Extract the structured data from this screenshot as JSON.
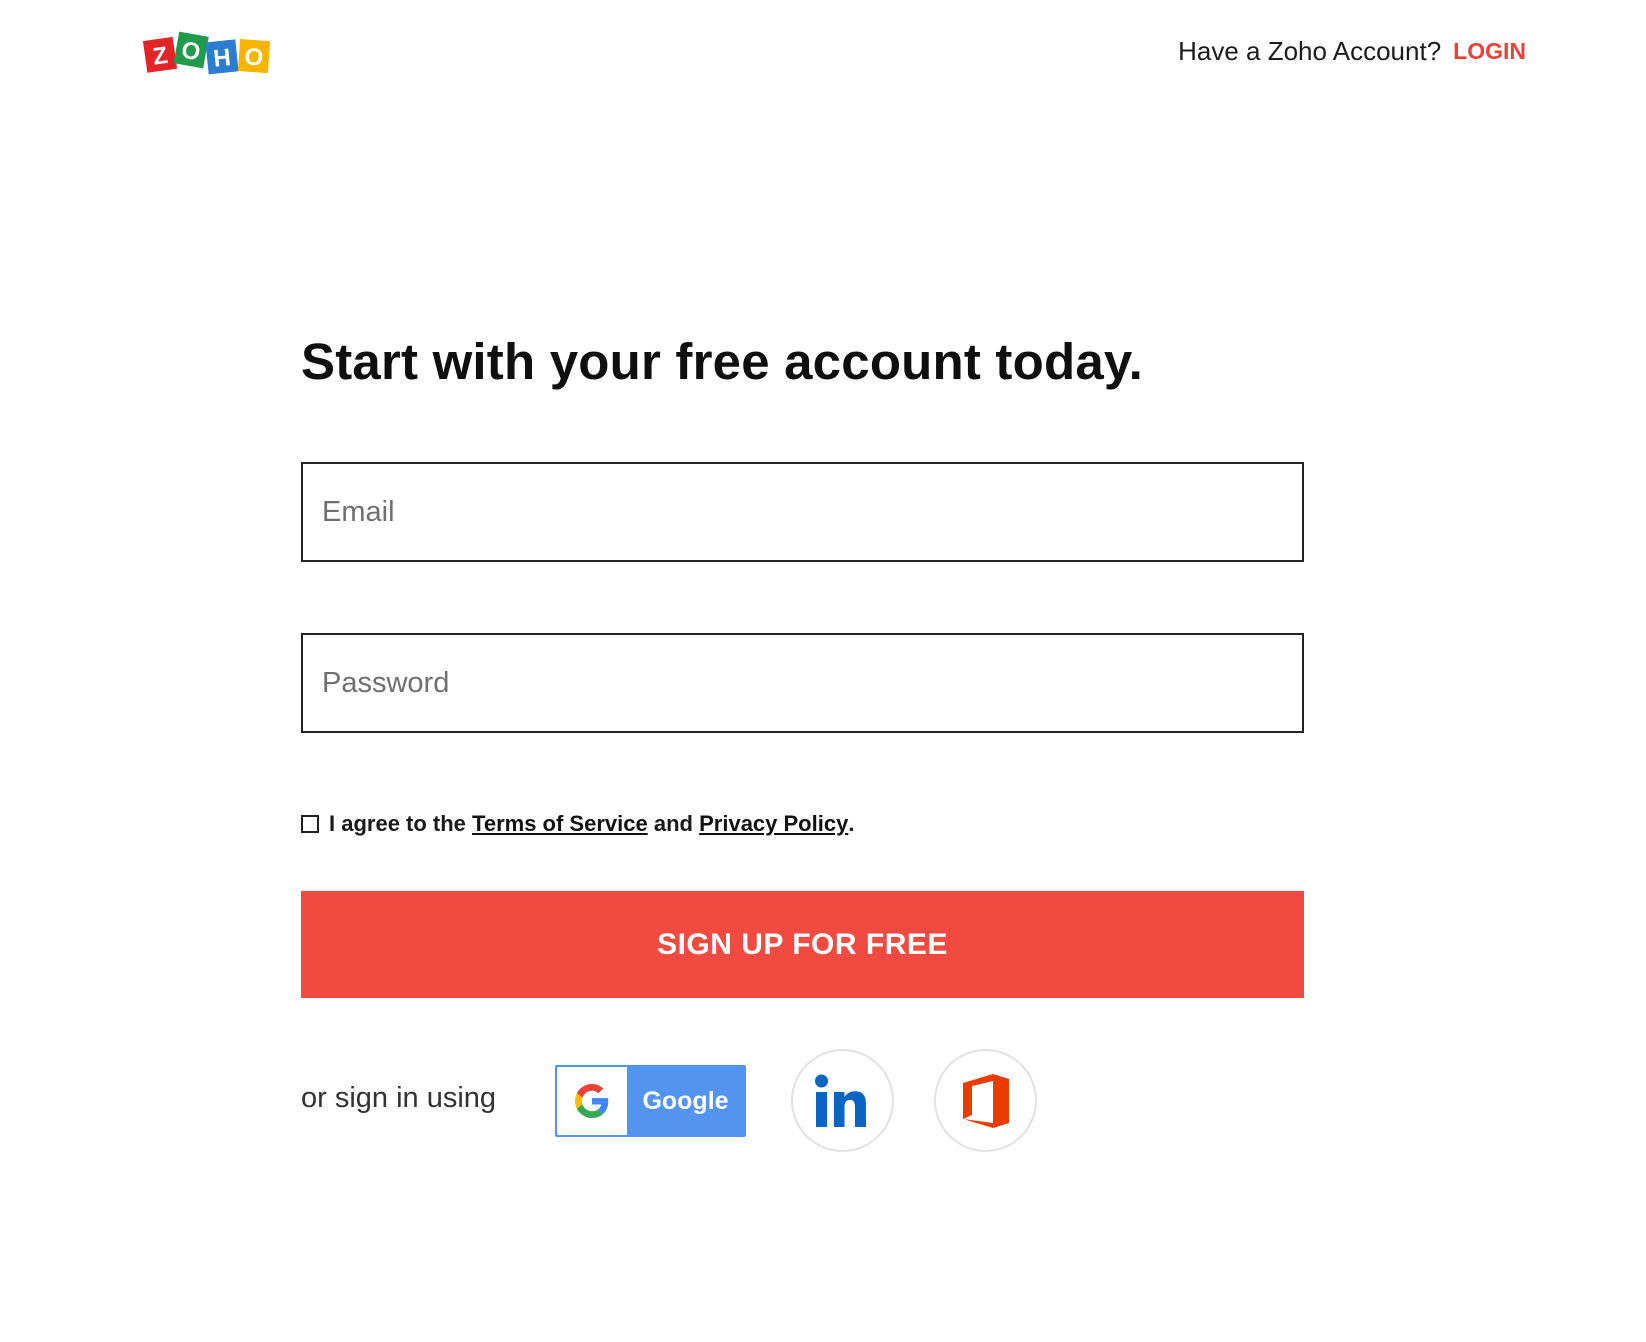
{
  "header": {
    "logo_letters": [
      "Z",
      "O",
      "H",
      "O"
    ],
    "account_prompt": "Have a Zoho Account?",
    "login_label": "LOGIN"
  },
  "form": {
    "heading": "Start with your free account today.",
    "email_placeholder": "Email",
    "password_placeholder": "Password",
    "agree_prefix": "I agree to the",
    "terms_label": "Terms of Service",
    "and_text": "and",
    "privacy_label": "Privacy Policy",
    "period": ".",
    "signup_label": "SIGN UP FOR FREE"
  },
  "social": {
    "or_sign_in": "or sign in using",
    "google_label": "Google",
    "google_icon": "google-g-icon",
    "linkedin_icon": "linkedin-icon",
    "office_icon": "office-icon"
  },
  "colors": {
    "accent": "#f14a41",
    "login": "#e9423a",
    "google_blue": "#5294f0",
    "linkedin_blue": "#0a66c2",
    "office_orange": "#eb3c00"
  }
}
